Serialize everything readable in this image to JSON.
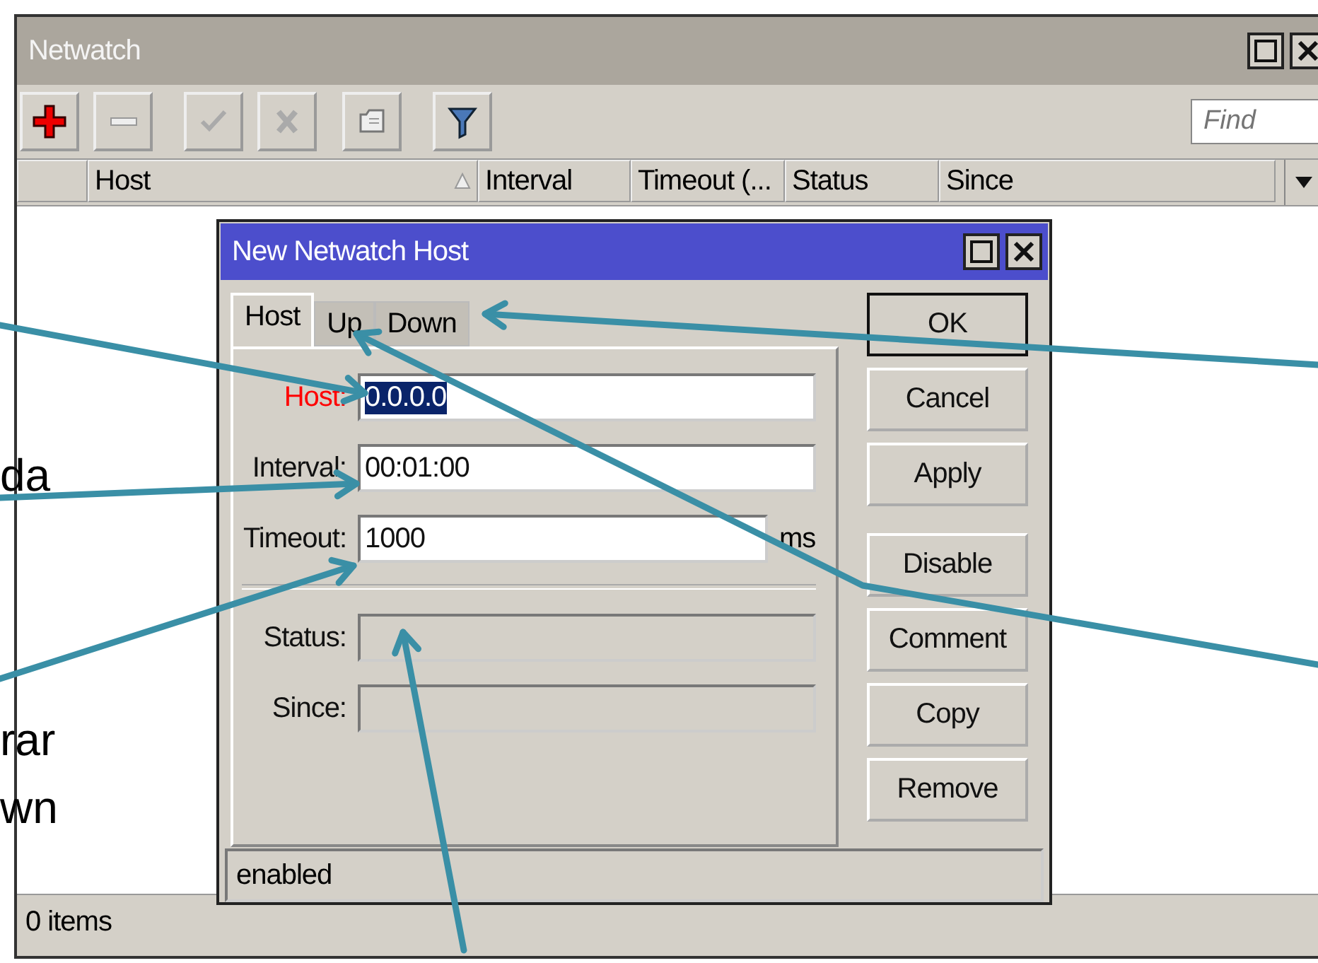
{
  "window": {
    "title": "Netwatch"
  },
  "find": {
    "placeholder": "Find"
  },
  "columns": [
    {
      "label": "Host",
      "sorted": true
    },
    {
      "label": "Interval",
      "sorted": false
    },
    {
      "label": "Timeout (...",
      "sorted": false
    },
    {
      "label": "Status",
      "sorted": false
    },
    {
      "label": "Since",
      "sorted": false
    }
  ],
  "status_bar": "0 items",
  "dialog": {
    "title": "New Netwatch Host",
    "tabs": [
      {
        "label": "Host",
        "selected": true
      },
      {
        "label": "Up",
        "selected": false
      },
      {
        "label": "Down",
        "selected": false
      }
    ],
    "fields": [
      {
        "label": "Host:",
        "value": "0.0.0.0",
        "required": true,
        "highlighted": true,
        "disabled": false
      },
      {
        "label": "Interval:",
        "value": "00:01:00",
        "required": false,
        "disabled": false
      },
      {
        "label": "Timeout:",
        "value": "1000",
        "unit": "ms",
        "required": false,
        "disabled": false
      },
      {
        "label": "Status:",
        "required": false,
        "disabled": true
      },
      {
        "label": "Since:",
        "required": false,
        "disabled": true
      }
    ],
    "buttons": [
      {
        "label": "OK",
        "default": true
      },
      {
        "label": "Cancel",
        "default": false
      },
      {
        "label": "Apply",
        "default": false
      },
      {
        "label": "Disable",
        "default": false
      },
      {
        "label": "Comment",
        "default": false
      },
      {
        "label": "Copy",
        "default": false
      },
      {
        "label": "Remove",
        "default": false
      }
    ],
    "status": "enabled"
  },
  "annotation_fragments": [
    "da",
    "rar",
    "wn"
  ]
}
